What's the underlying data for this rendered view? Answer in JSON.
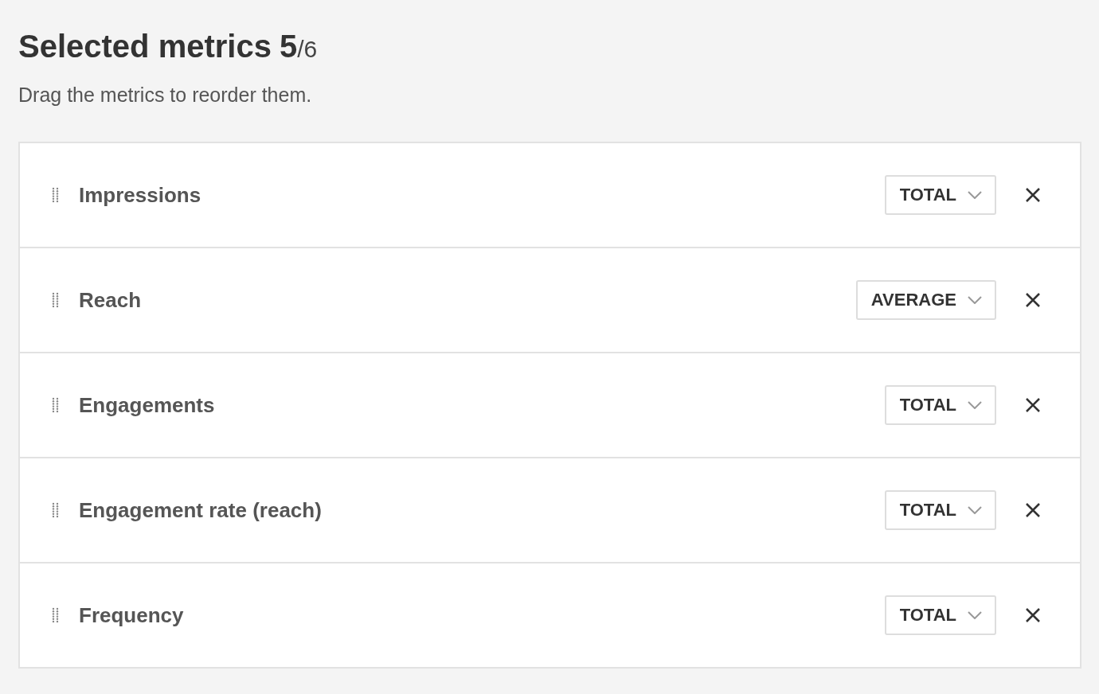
{
  "header": {
    "title": "Selected metrics",
    "count": "5",
    "total": "/6",
    "subtitle": "Drag the metrics to reorder them."
  },
  "metrics": [
    {
      "name": "Impressions",
      "aggregation": "TOTAL"
    },
    {
      "name": "Reach",
      "aggregation": "AVERAGE"
    },
    {
      "name": "Engagements",
      "aggregation": "TOTAL"
    },
    {
      "name": "Engagement rate (reach)",
      "aggregation": "TOTAL"
    },
    {
      "name": "Frequency",
      "aggregation": "TOTAL"
    }
  ]
}
